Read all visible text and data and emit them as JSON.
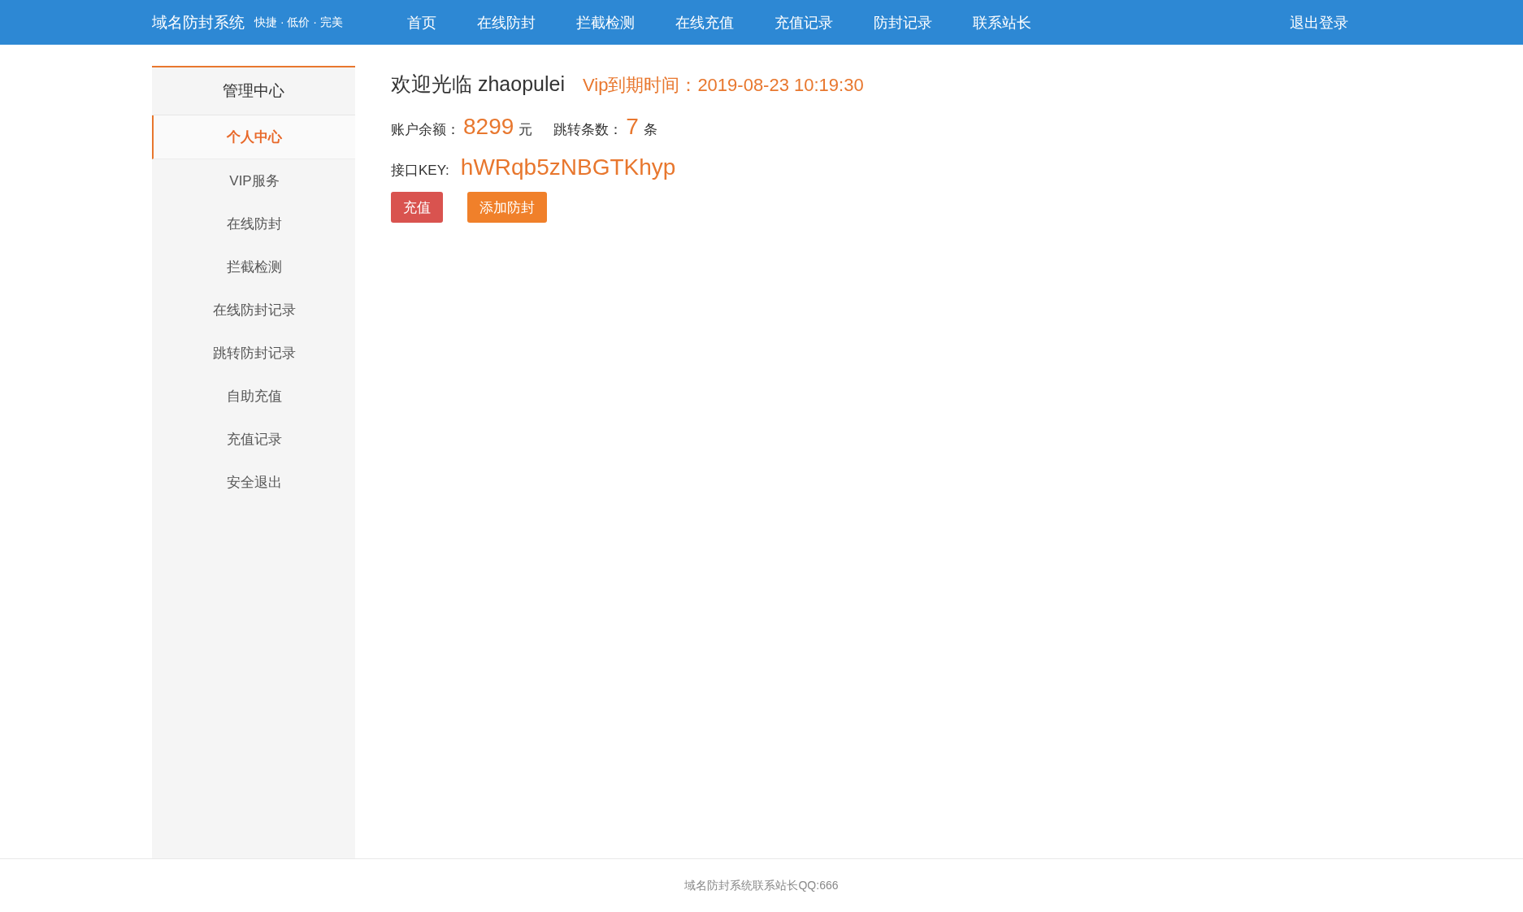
{
  "header": {
    "site_name": "域名防封系统",
    "slogan": "快捷 · 低价 · 完美",
    "nav": [
      {
        "label": "首页"
      },
      {
        "label": "在线防封"
      },
      {
        "label": "拦截检测"
      },
      {
        "label": "在线充值"
      },
      {
        "label": "充值记录"
      },
      {
        "label": "防封记录"
      },
      {
        "label": "联系站长"
      }
    ],
    "logout": "退出登录"
  },
  "sidebar": {
    "title": "管理中心",
    "items": [
      {
        "label": "个人中心",
        "selected": true
      },
      {
        "label": "VIP服务",
        "selected": false
      },
      {
        "label": "在线防封",
        "selected": false
      },
      {
        "label": "拦截检测",
        "selected": false
      },
      {
        "label": "在线防封记录",
        "selected": false
      },
      {
        "label": "跳转防封记录",
        "selected": false
      },
      {
        "label": "自助充值",
        "selected": false
      },
      {
        "label": "充值记录",
        "selected": false
      },
      {
        "label": "安全退出",
        "selected": false
      }
    ]
  },
  "profile": {
    "welcome": "欢迎光临 zhaopulei",
    "vip_expiry": "Vip到期时间：2019-08-23 10:19:30",
    "balance_label": "账户余额：",
    "balance": "8299",
    "balance_unit": "元",
    "jumps_label": "跳转条数：",
    "jumps": "7",
    "jumps_unit": "条",
    "key_label": "接口KEY:",
    "key": "hWRqb5zNBGTKhyp",
    "buttons": [
      {
        "label": "充值",
        "kind": "danger"
      },
      {
        "label": "添加防封",
        "kind": "warning"
      }
    ]
  },
  "footer": "域名防封系统联系站长QQ:666"
}
